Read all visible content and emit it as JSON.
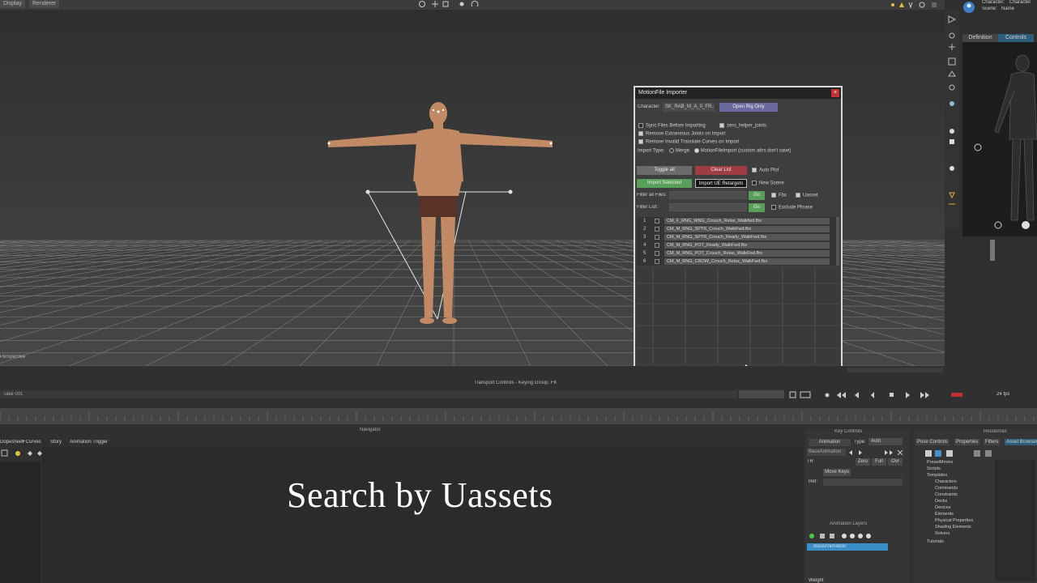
{
  "topbar": {
    "tab1": "Display",
    "tab2": "Renderer",
    "character_label": "Character:",
    "character_value": "Character",
    "scene_label": "Scene:",
    "scene_value": "Name"
  },
  "viewport": {
    "label": "Perspective"
  },
  "dialog": {
    "title": "MotionFile Importer",
    "character_label": "Character:",
    "character_value": "SK_RAB_M_A_0_FR...",
    "open_rig_button": "Open Rig Only",
    "opt_sync": "Sync Files Before Importing",
    "opt_zero_helper": "zero_helper_joints",
    "opt_remove_joints": "Remove Extraneous Joints on Import",
    "opt_remove_curves": "Remove Invalid Translate Curves on Import",
    "import_type_label": "Import Type:",
    "import_type_merge": "Merge",
    "import_type_motion": "MotionFileImport (custom attrs don't save)",
    "toggle_all": "Toggle all",
    "clear_list": "Clear List",
    "auto_plot": "Auto Plot",
    "import_selected": "Import Selected",
    "import_ue": "Import UE Retargets",
    "new_scene": "New Scene",
    "filter_files_label": "Filter all Files:",
    "go1": "Go",
    "fbx_label": "Fbx",
    "uasset_label": "Uasset",
    "filter_list_label": "Filter List:",
    "go2": "Go",
    "exclude_phrase": "Exclude Phrase",
    "files": [
      {
        "num": "1",
        "name": "CM_F_RNG_WNG_Crouch_Relax_Walkfwd.fbx"
      },
      {
        "num": "2",
        "name": "CM_M_RNG_SPTR_Crouch_WalkFwd.fbx"
      },
      {
        "num": "3",
        "name": "CM_M_RNG_SPTR_Crouch_Ready_WalkFwd.fbx"
      },
      {
        "num": "4",
        "name": "CM_M_RNG_POT_Ready_WalkFwd.fbx"
      },
      {
        "num": "5",
        "name": "CM_M_RNG_POT_Crouch_Relax_WalkFwd.fbx"
      },
      {
        "num": "6",
        "name": "CM_M_RNG_CROW_Crouch_Relax_WalkFwd.fbx"
      }
    ]
  },
  "rightpanel": {
    "tab_definition": "Definition",
    "tab_controls": "Controls"
  },
  "transport": {
    "title": "Transport Controls  -  Keying Group: FK",
    "take": "Take 001",
    "fps_value": "24 fps"
  },
  "navigator": {
    "label": "Navigator",
    "tabs": [
      "Dopesheet",
      "FCurves",
      "Story",
      "Animation Trigger"
    ]
  },
  "keycontrols": {
    "title": "Key Controls",
    "animation": "Animation",
    "type_label": "Type:",
    "type_value": "Auto",
    "base_animation": "BaseAnimation",
    "tr": "TR",
    "zero": "Zero",
    "full": "Full",
    "over": "Ovr",
    "move_keys": "Move Keys",
    "ref_label": "Ref:",
    "anim_layers": "Animation Layers",
    "weight_label": "Weight"
  },
  "resources": {
    "title": "Resources",
    "tabs": [
      "Pose Controls",
      "Properties",
      "Filters",
      "Asset Browser"
    ],
    "tree": [
      "PresetMoves",
      "Scripts",
      "Templates",
      "Characters",
      "Commands",
      "Constraints",
      "Decks",
      "Devices",
      "Elements",
      "Physical Properties",
      "Shading Elements",
      "Solvers",
      "Tutorials"
    ]
  },
  "caption": "Search by Uassets"
}
